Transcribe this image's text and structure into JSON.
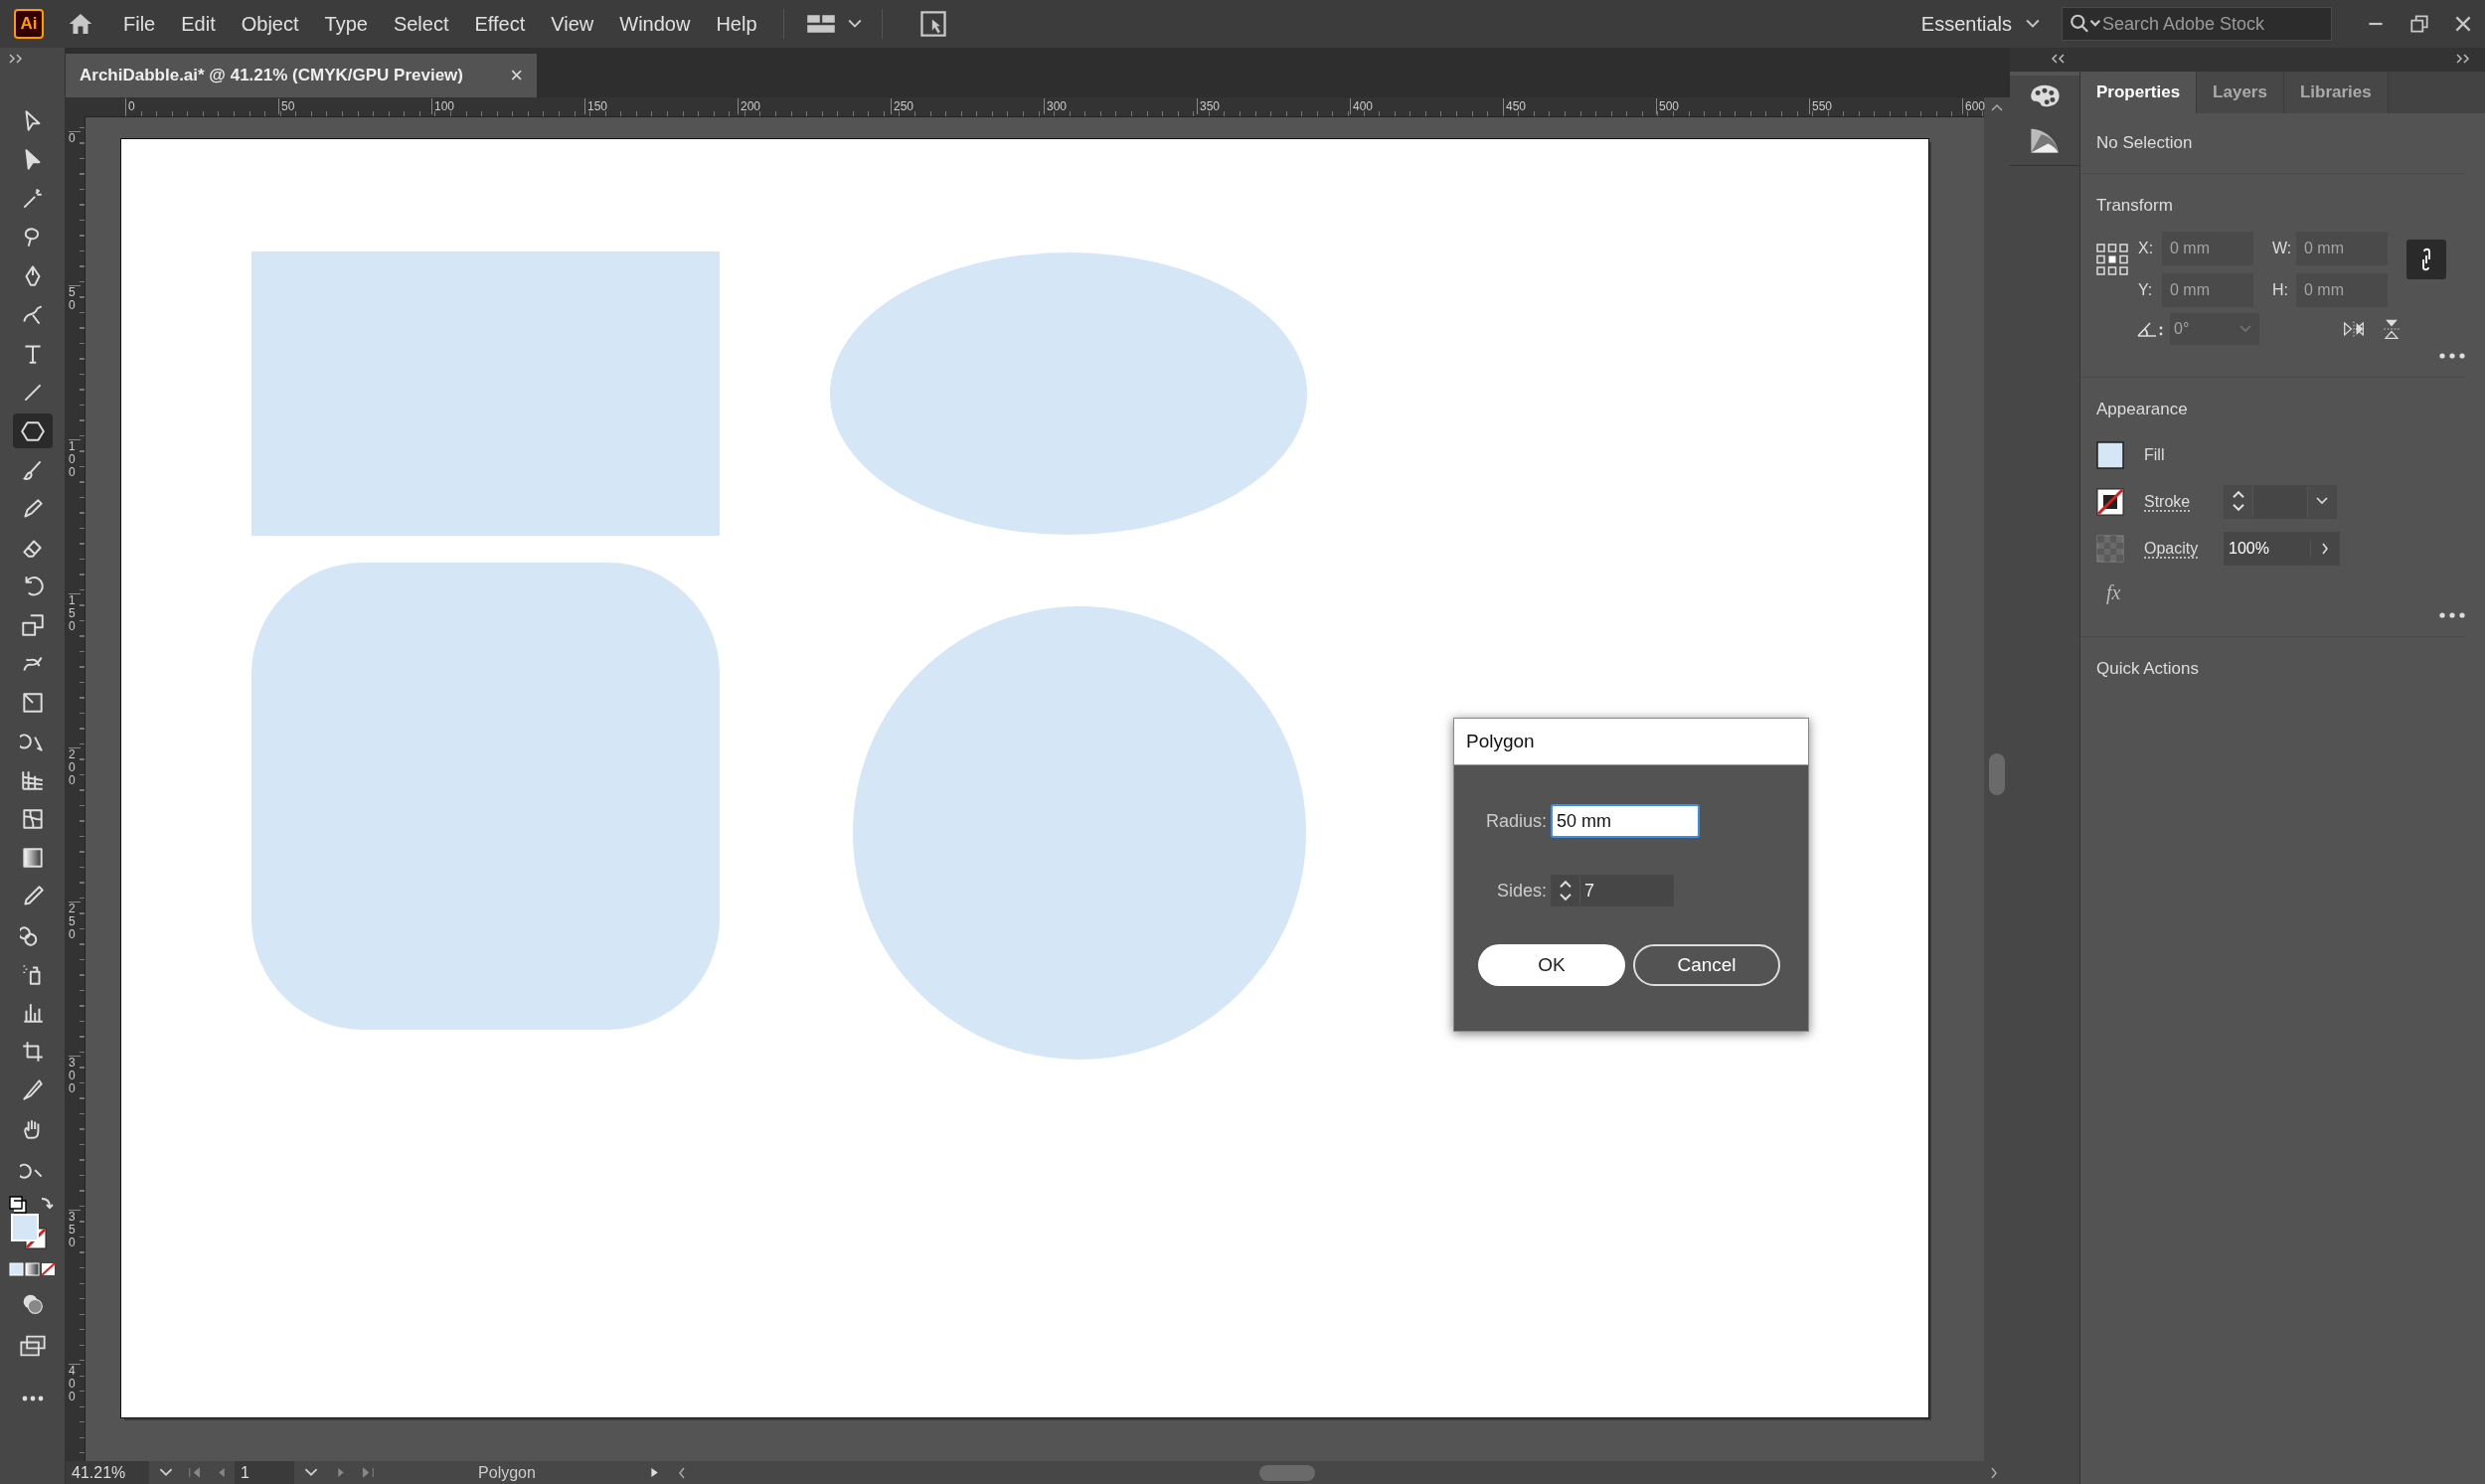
{
  "menubar": {
    "logo": "Ai",
    "menus": [
      "File",
      "Edit",
      "Object",
      "Type",
      "Select",
      "Effect",
      "View",
      "Window",
      "Help"
    ],
    "workspace": "Essentials",
    "search": {
      "placeholder": "Search Adobe Stock"
    }
  },
  "document_tab": {
    "title": "ArchiDabble.ai* @ 41.21% (CMYK/GPU Preview)",
    "close": "×"
  },
  "tools": [
    {
      "selected": false
    },
    {
      "selected": false
    },
    {
      "selected": false
    },
    {
      "selected": false
    },
    {
      "selected": false
    },
    {
      "selected": false
    },
    {
      "selected": false
    },
    {
      "selected": false
    },
    {
      "selected": true
    },
    {
      "selected": false
    },
    {
      "selected": false
    },
    {
      "selected": false
    },
    {
      "selected": false
    },
    {
      "selected": false
    },
    {
      "selected": false
    },
    {
      "selected": false
    },
    {
      "selected": false
    },
    {
      "selected": false
    },
    {
      "selected": false
    },
    {
      "selected": false
    },
    {
      "selected": false
    },
    {
      "selected": false
    },
    {
      "selected": false
    },
    {
      "selected": false
    },
    {
      "selected": false
    },
    {
      "selected": false
    },
    {
      "selected": false
    },
    {
      "selected": false
    }
  ],
  "rulers": {
    "horizontal": [
      "0",
      "50",
      "100",
      "150",
      "200",
      "250",
      "300",
      "350",
      "400",
      "450",
      "500",
      "550",
      "600"
    ],
    "vertical": [
      "0",
      "50",
      "100",
      "150",
      "200",
      "250",
      "300",
      "350",
      "400"
    ]
  },
  "dialog": {
    "title": "Polygon",
    "fields": [
      {
        "label": "Radius:",
        "value": "50 mm",
        "kind": "text"
      },
      {
        "label": "Sides:",
        "value": "7",
        "kind": "spinner"
      }
    ],
    "buttons": [
      {
        "label": "OK",
        "kind": "primary"
      },
      {
        "label": "Cancel",
        "kind": "secondary"
      }
    ]
  },
  "panel": {
    "tabs": [
      {
        "label": "Properties",
        "selected": true
      },
      {
        "label": "Layers",
        "selected": false
      },
      {
        "label": "Libraries",
        "selected": false
      }
    ],
    "selection": "No Selection",
    "transform": {
      "title": "Transform",
      "disabled": true,
      "fields": [
        {
          "label": "X:",
          "value": "0 mm"
        },
        {
          "label": "W:",
          "value": "0 mm"
        },
        {
          "label": "Y:",
          "value": "0 mm"
        },
        {
          "label": "H:",
          "value": "0 mm"
        }
      ],
      "angle": "0°"
    },
    "appearance": {
      "title": "Appearance",
      "rows": [
        {
          "kind": "fill",
          "label": "Fill"
        },
        {
          "kind": "stroke",
          "label": "Stroke"
        },
        {
          "kind": "opacity",
          "label": "Opacity",
          "value": "100%"
        }
      ],
      "effects": "fx"
    },
    "quick_actions": {
      "title": "Quick Actions"
    }
  },
  "status_bar": {
    "zoom": "41.21%",
    "page": "1",
    "tool": "Polygon"
  }
}
